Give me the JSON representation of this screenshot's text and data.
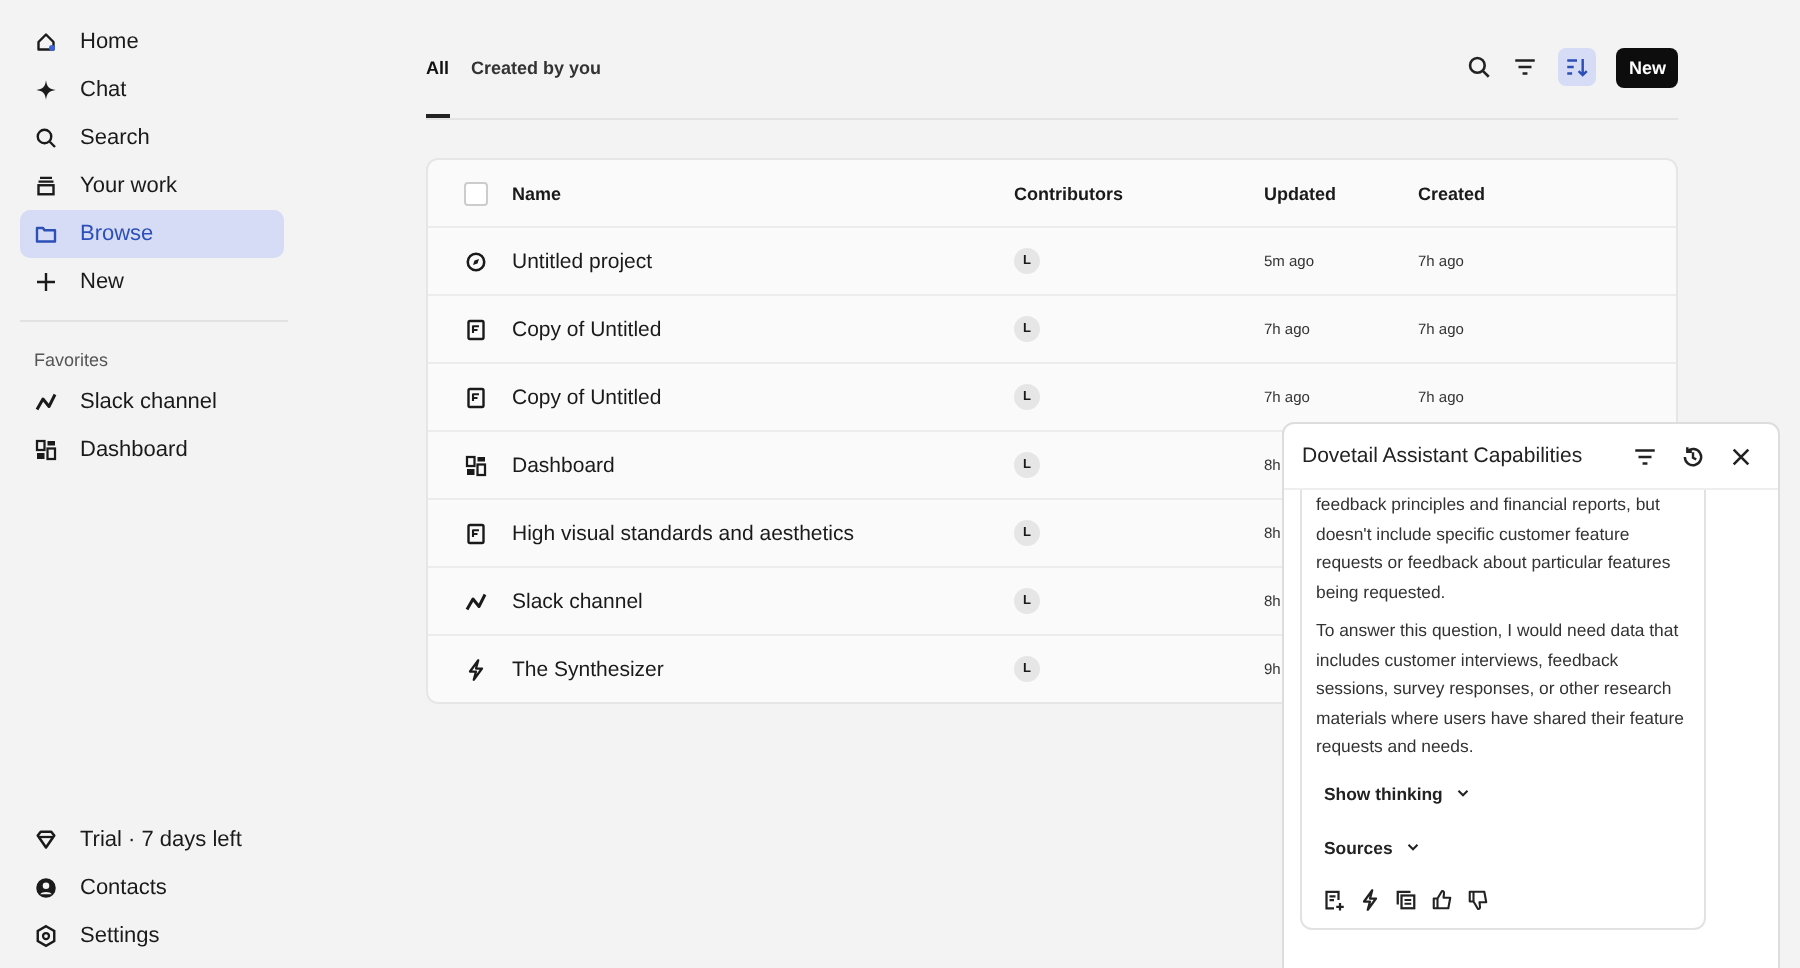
{
  "sidebar": {
    "items": [
      {
        "label": "Home",
        "kind": "home",
        "selected": false
      },
      {
        "label": "Chat",
        "kind": "sparkle",
        "selected": false
      },
      {
        "label": "Search",
        "kind": "search",
        "selected": false
      },
      {
        "label": "Your work",
        "kind": "stack",
        "selected": false
      },
      {
        "label": "Browse",
        "kind": "folder",
        "selected": true
      },
      {
        "label": "New",
        "kind": "plus",
        "selected": false
      }
    ],
    "favorites_heading": "Favorites",
    "favorites": [
      {
        "label": "Slack channel",
        "kind": "chart"
      },
      {
        "label": "Dashboard",
        "kind": "dashboard"
      }
    ],
    "footer": [
      {
        "label": "Trial · 7 days left",
        "kind": "gem"
      },
      {
        "label": "Contacts",
        "kind": "person"
      },
      {
        "label": "Settings",
        "kind": "gear"
      }
    ]
  },
  "tabs": [
    {
      "label": "All",
      "selected": true
    },
    {
      "label": "Created by you",
      "selected": false
    }
  ],
  "toolbar": {
    "sort_active": true,
    "new_button": "New"
  },
  "table": {
    "columns": [
      "Name",
      "Contributors",
      "Updated",
      "Created"
    ],
    "all_checked": false,
    "rows": [
      {
        "kind": "project",
        "name": "Untitled project",
        "contributor": "L",
        "updated": "5m ago",
        "created": "7h ago"
      },
      {
        "kind": "doc",
        "name": "Copy of Untitled",
        "contributor": "L",
        "updated": "7h ago",
        "created": "7h ago"
      },
      {
        "kind": "doc",
        "name": "Copy of Untitled",
        "contributor": "L",
        "updated": "7h ago",
        "created": "7h ago"
      },
      {
        "kind": "dashboard",
        "name": "Dashboard",
        "contributor": "L",
        "updated": "8h"
      },
      {
        "kind": "doc",
        "name": "High visual standards and aesthetics",
        "contributor": "L",
        "updated": "8h"
      },
      {
        "kind": "chart",
        "name": "Slack channel",
        "contributor": "L",
        "updated": "8h"
      },
      {
        "kind": "bolt",
        "name": "The Synthesizer",
        "contributor": "L",
        "updated": "9h"
      }
    ]
  },
  "assistant": {
    "title": "Dovetail Assistant Capabilities",
    "paragraphs": [
      "feedback principles and financial reports, but doesn't include specific customer feature requests or feedback about particular features being requested.",
      "To answer this question, I would need data that includes customer interviews, feedback sessions, survey responses, or other research materials where users have shared their feature requests and needs."
    ],
    "toggles": [
      "Show thinking",
      "Sources"
    ]
  }
}
